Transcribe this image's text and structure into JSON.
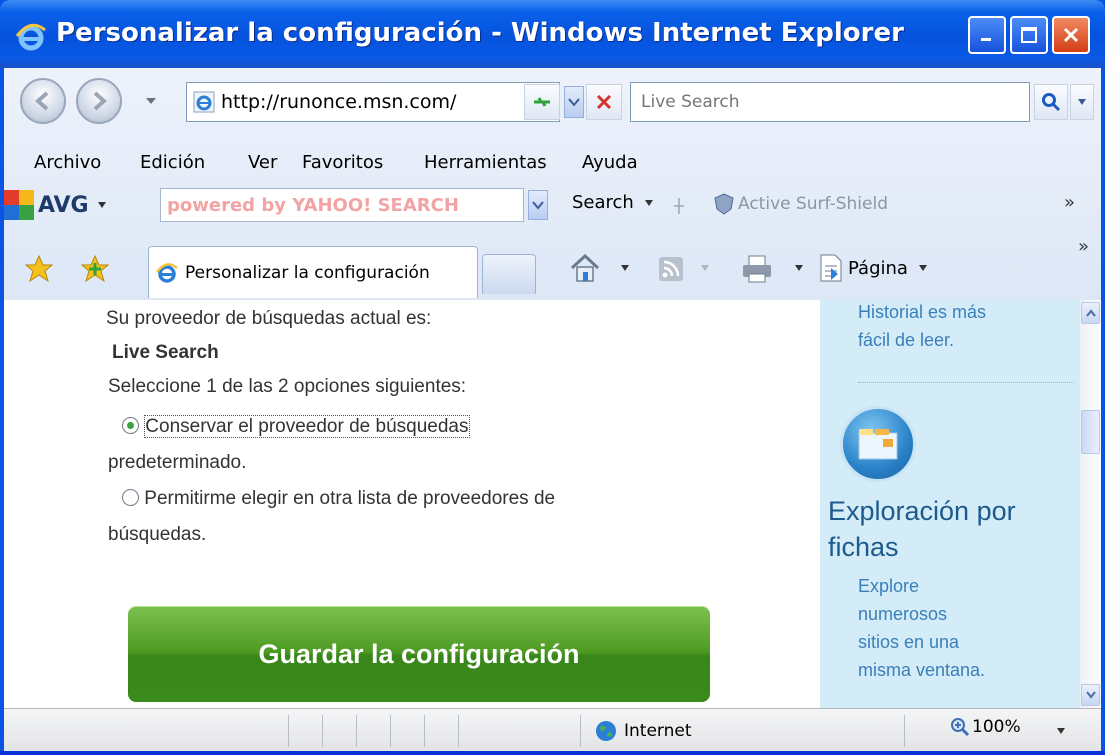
{
  "window": {
    "title": "Personalizar la configuración - Windows Internet Explorer"
  },
  "navbar": {
    "address": "http://runonce.msn.com/",
    "search_placeholder": "Live Search"
  },
  "menu": {
    "items": [
      "Archivo",
      "Edición",
      "Ver",
      "Favoritos",
      "Herramientas",
      "Ayuda"
    ]
  },
  "toolbar": {
    "avg_label": "AVG",
    "yahoo_placeholder": "powered by YAHOO! SEARCH",
    "search_label": "Search",
    "surfshield_label": "Active Surf-Shield",
    "more_label": "»"
  },
  "tabs": {
    "active_label": "Personalizar la configuración",
    "page_menu_label": "Página",
    "more_label": "»"
  },
  "content": {
    "intro": "Su proveedor de búsquedas actual es:",
    "current_provider": "Live Search",
    "instruction": "Seleccione 1 de las 2 opciones siguientes:",
    "option1_line1": "Conservar el proveedor de búsquedas",
    "option1_line2": "predeterminado.",
    "option2_line1": "Permitirme elegir en otra lista de proveedores de",
    "option2_line2": "búsquedas.",
    "save_button": "Guardar la configuración"
  },
  "sidebar": {
    "prev_line1": "Historial es más",
    "prev_line2": "fácil de leer.",
    "feature_title_line1": "Exploración por",
    "feature_title_line2": "fichas",
    "feature_desc": [
      "Explore",
      "numerosos",
      "sitios en una",
      "misma ventana."
    ]
  },
  "statusbar": {
    "zone": "Internet",
    "zoom": "100%"
  },
  "colors": {
    "titlebar": "#0553dd",
    "sidebar_bg": "#d4ecf8",
    "save_button": "#4d9a23",
    "sidebar_link": "#3b7fb9"
  }
}
